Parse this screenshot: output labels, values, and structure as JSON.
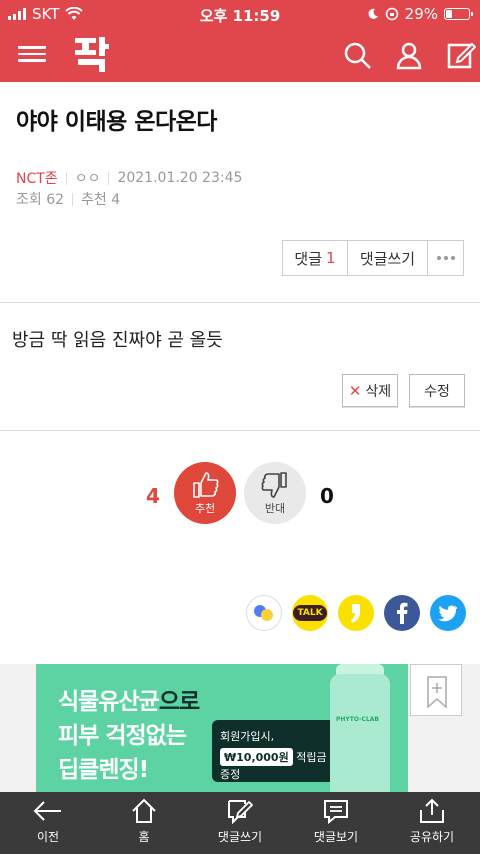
{
  "status_bar": {
    "carrier": "SKT",
    "time": "오후 11:59",
    "battery": "29%",
    "battery_level": 0.29
  },
  "header": {
    "logo_text": "판",
    "icons": [
      "menu-icon",
      "search-icon",
      "user-icon",
      "write-icon"
    ]
  },
  "post": {
    "title": "야야 이태용 온다온다",
    "author": "NCT존",
    "author_sub": "ㅇㅇ",
    "datetime": "2021.01.20 23:45",
    "views": "조회 62",
    "recommend": "추천 4"
  },
  "actions": {
    "comment_label": "댓글",
    "comment_count": "1",
    "write_comment": "댓글쓰기"
  },
  "comment": {
    "text": "방금 딱 읽음 진짜야 곧 올듯",
    "delete_label": "삭제",
    "edit_label": "수정"
  },
  "vote": {
    "up_count": "4",
    "up_label": "추천",
    "down_label": "반대",
    "down_count": "0"
  },
  "share": {
    "icons": [
      "dual-icon",
      "kakaotalk-icon",
      "kakaostory-icon",
      "facebook-icon",
      "twitter-icon"
    ],
    "kakaotalk_text": "TALK",
    "colors": {
      "kakao": "#fae100",
      "facebook": "#3b5998",
      "twitter": "#1da1f2"
    }
  },
  "ad": {
    "line1_a": "식물유산균",
    "line1_b": "으로",
    "line2": "피부 걱정없는",
    "line3": "딥클렌징!",
    "bubble_line1": "회원가입시,",
    "bubble_highlight": "₩10,000원",
    "bubble_line2": "적립금 증정",
    "product_label": "PHYTO-CLAB"
  },
  "bottom_nav": [
    {
      "label": "이전",
      "icon": "back-arrow-icon"
    },
    {
      "label": "홈",
      "icon": "home-icon"
    },
    {
      "label": "댓글쓰기",
      "icon": "write-comment-icon"
    },
    {
      "label": "댓글보기",
      "icon": "view-comments-icon"
    },
    {
      "label": "공유하기",
      "icon": "share-icon"
    }
  ],
  "colors": {
    "brand": "#e0474d",
    "recommend": "#e0473b",
    "bottom_bar": "#3a3a3a"
  }
}
